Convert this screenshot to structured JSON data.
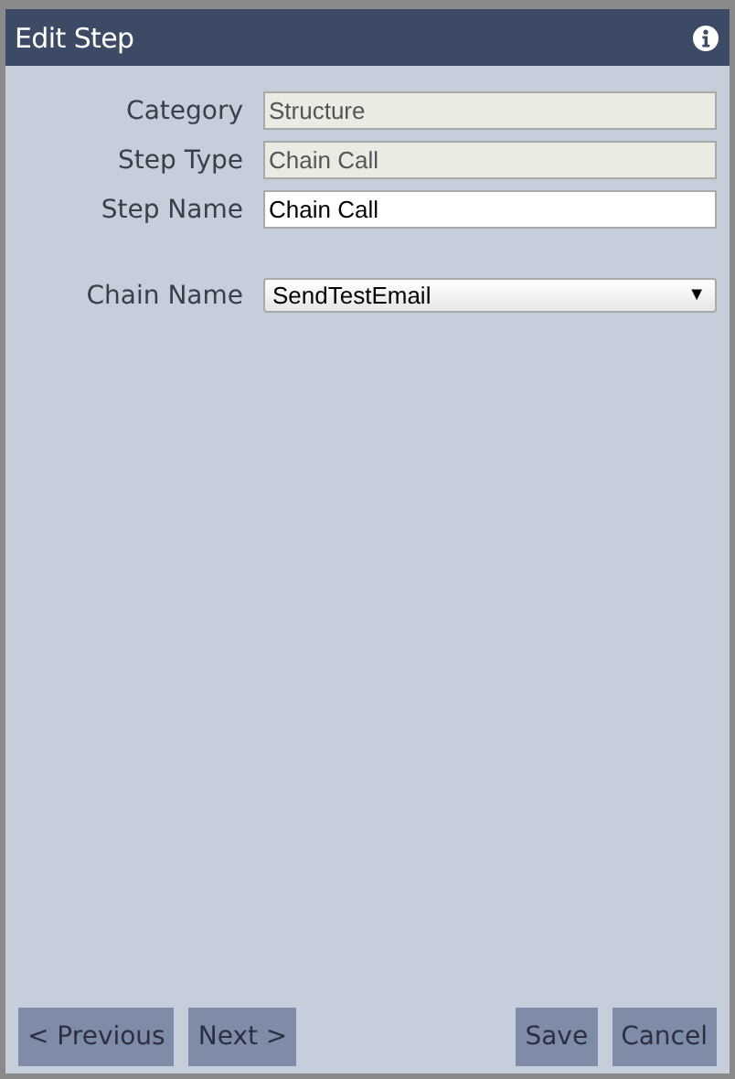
{
  "window": {
    "title": "Edit Step"
  },
  "fields": [
    {
      "label": "Category",
      "kind": "text",
      "value": "Structure",
      "disabled": true
    },
    {
      "label": "Step Type",
      "kind": "text",
      "value": "Chain Call",
      "disabled": true
    },
    {
      "label": "Step Name",
      "kind": "text",
      "value": "Chain Call",
      "disabled": false
    },
    {
      "label": "Chain Name",
      "kind": "select",
      "value": "SendTestEmail",
      "disabled": false
    }
  ],
  "dropdown_arrow": "▼",
  "nav_buttons": [
    "< Previous",
    "Next >"
  ],
  "action_buttons": [
    "Save",
    "Cancel"
  ]
}
